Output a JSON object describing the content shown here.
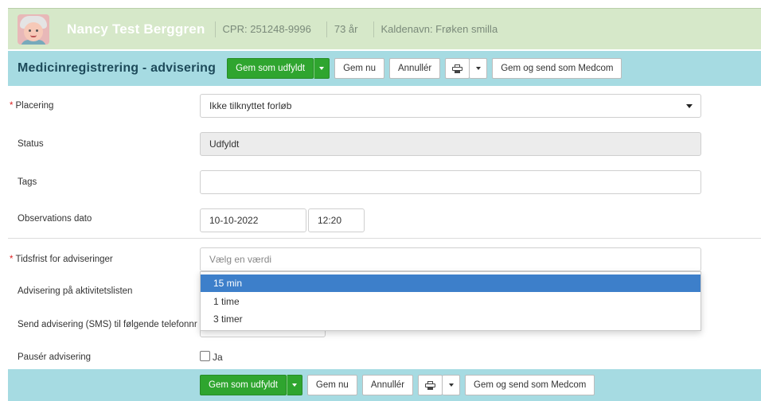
{
  "patient": {
    "name": "Nancy Test Berggren",
    "cpr": "CPR: 251248-9996",
    "age": "73 år",
    "nickname": "Kaldenavn: Frøken smilla"
  },
  "page": {
    "title": "Medicinregistrering - advisering"
  },
  "toolbar": {
    "save_filled": "Gem som udfyldt",
    "save_now": "Gem nu",
    "cancel": "Annullér",
    "send_medcom": "Gem og send som Medcom"
  },
  "form": {
    "placement": {
      "label": "Placering",
      "value": "Ikke tilknyttet forløb",
      "required": true
    },
    "status": {
      "label": "Status",
      "value": "Udfyldt"
    },
    "tags": {
      "label": "Tags",
      "value": ""
    },
    "observation": {
      "label": "Observations dato",
      "date": "10-10-2022",
      "time": "12:20"
    },
    "deadline": {
      "label": "Tidsfrist for adviseringer",
      "placeholder": "Vælg en værdi",
      "required": true
    },
    "activity_list": {
      "label": "Advisering på aktivitetslisten"
    },
    "sms": {
      "label": "Send advisering (SMS) til følgende telefonnr"
    },
    "pause": {
      "label": "Pausér advisering",
      "checkbox_label": "Ja",
      "checked": false
    }
  },
  "dropdown": {
    "options": [
      "15 min",
      "1 time",
      "3 timer"
    ],
    "selected_index": 0
  },
  "colors": {
    "patient_bar": "#d6e8c9",
    "toolbar": "#a6dbe2",
    "primary_button": "#2fa52f",
    "dropdown_highlight": "#3d7fca",
    "required_marker": "#dd2222"
  },
  "icons": {
    "print": "printer-icon",
    "caret": "chevron-down-icon",
    "avatar": "patient-avatar-image"
  }
}
